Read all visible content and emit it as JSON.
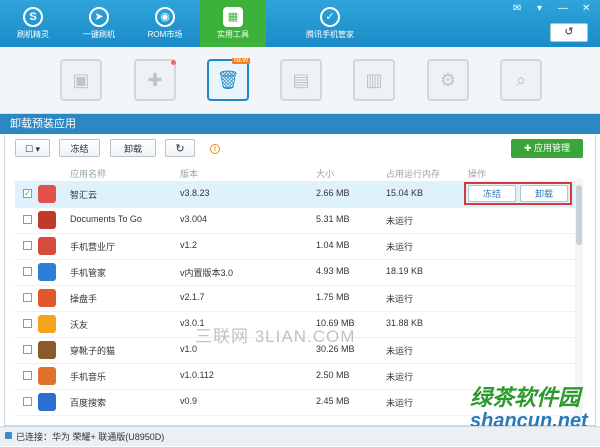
{
  "nav": {
    "tabs": [
      {
        "label": "刷机精灵",
        "icon": "s-logo-icon"
      },
      {
        "label": "一键刷机",
        "icon": "cursor-icon"
      },
      {
        "label": "ROM市场",
        "icon": "robot-icon"
      },
      {
        "label": "实用工具",
        "icon": "grid-icon",
        "active": true
      },
      {
        "label": "腾讯手机管家",
        "icon": "shield-icon"
      }
    ],
    "window_controls": [
      "✉",
      "▾",
      "—",
      "✕"
    ],
    "refresh_symbol": "↺"
  },
  "tools": {
    "new_badge": "NEW"
  },
  "section": {
    "title": "卸载预装应用"
  },
  "toolbar": {
    "freeze_label": "冻结",
    "uninstall_label": "卸载",
    "refresh_symbol": "↻",
    "warn_symbol": "!",
    "app_manage_label": "应用管理"
  },
  "table": {
    "headers": {
      "name": "应用名称",
      "version": "版本",
      "size": "大小",
      "mem": "占用运行内存",
      "op": "操作"
    },
    "rows": [
      {
        "name": "智汇云",
        "version": "v3.8.23",
        "size": "2.66 MB",
        "mem": "15.04 KB",
        "checked": true,
        "color": "#e0524a"
      },
      {
        "name": "Documents To Go",
        "version": "v3.004",
        "size": "5.31 MB",
        "mem": "未运行",
        "checked": false,
        "color": "#c0392b"
      },
      {
        "name": "手机营业厅",
        "version": "v1.2",
        "size": "1.04 MB",
        "mem": "未运行",
        "checked": false,
        "color": "#d64b3b"
      },
      {
        "name": "手机管家",
        "version": "v内置版本3.0",
        "size": "4.93 MB",
        "mem": "18.19 KB",
        "checked": false,
        "color": "#2b7fd4"
      },
      {
        "name": "操盘手",
        "version": "v2.1.7",
        "size": "1.75 MB",
        "mem": "未运行",
        "checked": false,
        "color": "#e3572e"
      },
      {
        "name": "沃友",
        "version": "v3.0.1",
        "size": "10.69 MB",
        "mem": "31.88 KB",
        "checked": false,
        "color": "#f2a51a"
      },
      {
        "name": "穿靴子的猫",
        "version": "v1.0",
        "size": "30.26 MB",
        "mem": "未运行",
        "checked": false,
        "color": "#8a5a2b"
      },
      {
        "name": "手机音乐",
        "version": "v1.0.112",
        "size": "2.50 MB",
        "mem": "未运行",
        "checked": false,
        "color": "#e0702a"
      },
      {
        "name": "百度搜索",
        "version": "v0.9",
        "size": "2.45 MB",
        "mem": "未运行",
        "checked": false,
        "color": "#2a6fd0"
      }
    ],
    "row_actions": {
      "freeze": "冻结",
      "uninstall": "卸载"
    }
  },
  "status": {
    "text": "已连接：华为 荣耀+ 联通版(U8950D)"
  },
  "watermarks": {
    "center": "三联网 3LIAN.COM",
    "brand_cn": "绿茶软件园",
    "brand_url": "shancun.net"
  }
}
